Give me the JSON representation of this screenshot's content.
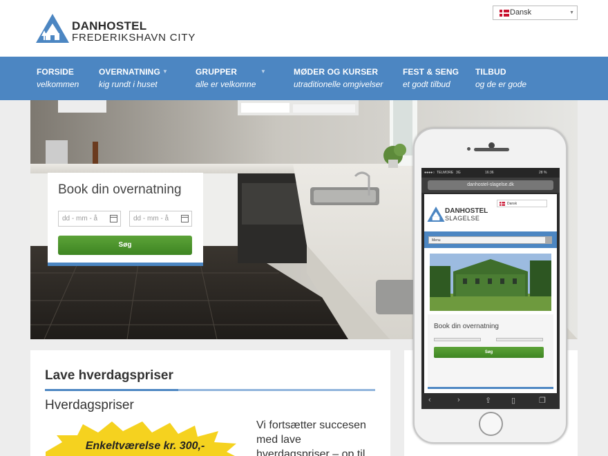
{
  "header": {
    "logo_line1": "DANHOSTEL",
    "logo_line2": "FREDERIKSHAVN CITY",
    "language": "Dansk"
  },
  "nav": [
    {
      "title": "FORSIDE",
      "subtitle": "velkommen",
      "dropdown": false
    },
    {
      "title": "OVERNATNING",
      "subtitle": "kig rundt i huset",
      "dropdown": true
    },
    {
      "title": "GRUPPER",
      "subtitle": "alle er velkomne",
      "dropdown": true
    },
    {
      "title": "MØDER OG KURSER",
      "subtitle": "utraditionelle omgivelser",
      "dropdown": false
    },
    {
      "title": "FEST & SENG",
      "subtitle": "et godt tilbud",
      "dropdown": false
    },
    {
      "title": "TILBUD",
      "subtitle": "og de er gode",
      "dropdown": false
    }
  ],
  "booking": {
    "title": "Book din overnatning",
    "date_placeholder_from": "dd - mm - å",
    "date_placeholder_to": "dd - mm - å",
    "submit_label": "Søg"
  },
  "content": {
    "heading": "Lave hverdagspriser",
    "subheading": "Hverdagspriser",
    "burst_text": "Enkeltværelse kr. 300,-",
    "paragraph": "Vi fortsætter succesen med lave hverdagspriser – op til"
  },
  "phone": {
    "carrier": "TELMORE",
    "network": "3G",
    "time": "16:36",
    "battery": "28 %",
    "url": "danhostel-slagelse.dk",
    "logo_line1": "DANHOSTEL",
    "logo_line2": "SLAGELSE",
    "language": "Dansk",
    "menu_label": "Menu",
    "book_title": "Book din overnatning",
    "submit_label": "Søg"
  },
  "colors": {
    "nav_blue": "#4c86c2",
    "button_green": "#4c9a2e",
    "burst_yellow": "#f5d21f"
  }
}
